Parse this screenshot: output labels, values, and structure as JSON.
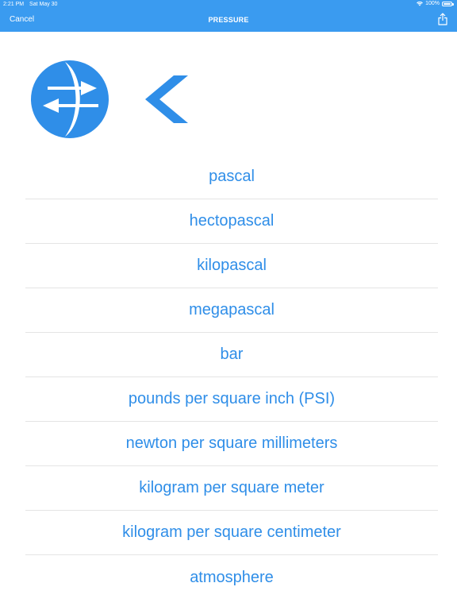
{
  "status_bar": {
    "time": "2:21 PM",
    "date": "Sat May 30",
    "battery": "100%"
  },
  "nav": {
    "cancel_label": "Cancel",
    "title": "PRESSURE",
    "share_icon": "share-icon"
  },
  "colors": {
    "accent": "#3a9bf0",
    "link": "#2f8ee8",
    "divider": "#e4e4e4"
  },
  "icons": {
    "logo": "conversion-arrows-icon",
    "back": "chevron-left-icon"
  },
  "units": [
    "pascal",
    "hectopascal",
    "kilopascal",
    "megapascal",
    "bar",
    "pounds per square inch (PSI)",
    "newton per square millimeters",
    "kilogram per square meter",
    "kilogram per square centimeter",
    "atmosphere"
  ]
}
